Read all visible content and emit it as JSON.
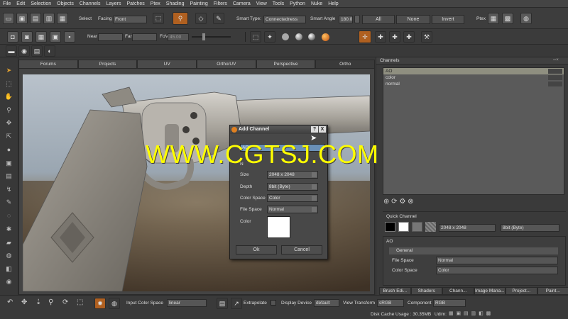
{
  "menu": [
    "File",
    "Edit",
    "Selection",
    "Objects",
    "Channels",
    "Layers",
    "Patches",
    "Ptex",
    "Shading",
    "Painting",
    "Filters",
    "Camera",
    "View",
    "Tools",
    "Python",
    "Nuke",
    "Help"
  ],
  "toolbar1": {
    "select_label": "Select",
    "facing_label": "Facing",
    "facing_value": "Front",
    "smart_type_label": "Smart Type:",
    "smart_type_value": "Connectedness",
    "smart_angle_label": "Smart Angle",
    "smart_angle_value": "180.0",
    "all_label": "All",
    "none_label": "None",
    "invert_label": "Invert",
    "ptex_label": "Ptex"
  },
  "toolbar2": {
    "near_label": "Near",
    "far_label": "Far",
    "fov_label": "FoV",
    "fov_value": "45.00"
  },
  "viewport_tabs": [
    "Forums",
    "Projects",
    "UV",
    "Ortho/UV",
    "Perspective",
    "Ortho"
  ],
  "active_tab": "Ortho",
  "channels_panel": {
    "title": "Channels",
    "items": [
      "AO",
      "color",
      "normal"
    ]
  },
  "quick_channel": {
    "title": "Quick Channel",
    "size_value": "2048 x 2048",
    "depth_value": "8bit (Byte)"
  },
  "properties": {
    "channel_name": "AO",
    "section": "General",
    "file_space_label": "File Space",
    "file_space_value": "Normal",
    "color_space_label": "Color Space",
    "color_space_value": "Color"
  },
  "right_bottom_tabs": [
    "Brush Edi...",
    "Shaders",
    "Chann...",
    "Image Mana...",
    "Project...",
    "Paint..."
  ],
  "dialog": {
    "title": "Add Channel",
    "help_label": "?",
    "close_label": "X",
    "name_value": "AO",
    "name_label": "N",
    "size_label": "Size",
    "size_value": "2048 x 2048",
    "depth_label": "Depth",
    "depth_value": "8bit (Byte)",
    "color_space_label": "Color Space",
    "color_space_value": "Color",
    "file_space_label": "File Space",
    "file_space_value": "Normal",
    "color_label": "Color",
    "ok_label": "Ok",
    "cancel_label": "Cancel"
  },
  "status": {
    "input_color_space_label": "Input Color Space",
    "input_color_space_value": "linear",
    "extrapolate_label": "Extrapolate",
    "display_device_label": "Display Device",
    "display_device_value": "default",
    "view_transform_label": "View Transform",
    "view_transform_value": "sRGB",
    "component_label": "Component",
    "component_value": "RGB",
    "disk_cache_label": "Disk Cache Usage : 30.35MB",
    "udim_label": "Udim:"
  },
  "watermark": "WWW.CGTSJ.COM"
}
